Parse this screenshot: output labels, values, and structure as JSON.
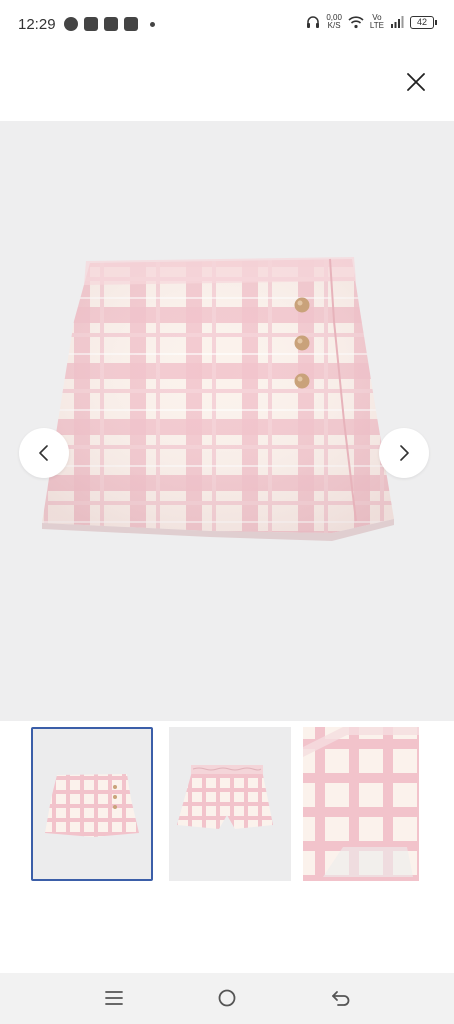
{
  "status_bar": {
    "time": "12:29",
    "net_speed_value": "0,00",
    "net_speed_unit": "K/S",
    "volte_top": "Vo",
    "volte_bottom": "LTE",
    "battery": "42"
  },
  "viewer": {
    "close_icon": "close-icon",
    "prev_icon": "chevron-left-icon",
    "next_icon": "chevron-right-icon",
    "main_image": "pink-plaid-skort-front",
    "thumbnails": [
      {
        "image": "pink-plaid-skort-front",
        "selected": true
      },
      {
        "image": "pink-plaid-skort-back",
        "selected": false
      },
      {
        "image": "pink-plaid-skort-detail",
        "selected": false
      }
    ]
  },
  "nav_bar": {
    "menu_icon": "menu-icon",
    "home_icon": "home-icon",
    "back_icon": "back-icon"
  },
  "colors": {
    "image_bg": "#eeeeef",
    "plaid_pink": "#f0b9c2",
    "plaid_cream": "#fbf2ec",
    "button_gold": "#c9a27a",
    "selected_border": "#3b5ea8"
  }
}
